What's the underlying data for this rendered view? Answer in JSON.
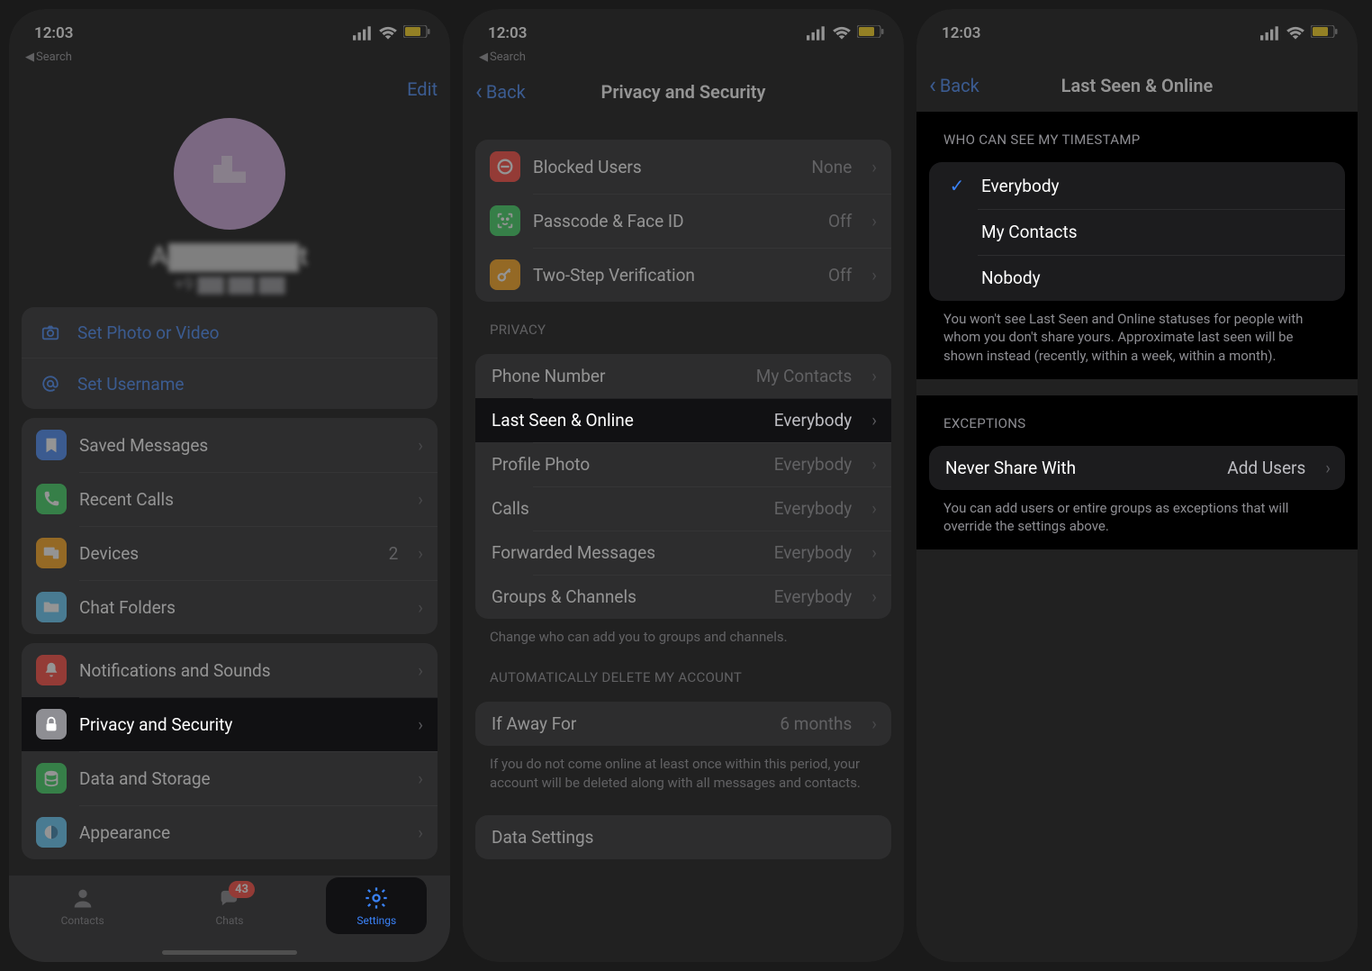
{
  "status": {
    "time": "12:03",
    "breadcrumb_back": "Search"
  },
  "screen1": {
    "edit": "Edit",
    "name_obscured": "A▇▇▇▇▇▇t",
    "phone_obscured": "+9 ▇▇ ▇▇ ▇▇",
    "actions": {
      "set_photo": "Set Photo or Video",
      "set_username": "Set Username"
    },
    "rows1": {
      "saved": "Saved Messages",
      "recent": "Recent Calls",
      "devices": "Devices",
      "devices_val": "2",
      "folders": "Chat Folders"
    },
    "rows2": {
      "notif": "Notifications and Sounds",
      "privacy": "Privacy and Security",
      "data": "Data and Storage",
      "appearance": "Appearance"
    },
    "tabs": {
      "contacts": "Contacts",
      "chats": "Chats",
      "chats_badge": "43",
      "settings": "Settings"
    }
  },
  "screen2": {
    "back": "Back",
    "title": "Privacy and Security",
    "sec1": {
      "blocked": "Blocked Users",
      "blocked_val": "None",
      "passcode": "Passcode & Face ID",
      "passcode_val": "Off",
      "twostep": "Two-Step Verification",
      "twostep_val": "Off"
    },
    "privacy_header": "PRIVACY",
    "privacy": {
      "phone": "Phone Number",
      "phone_val": "My Contacts",
      "lastseen": "Last Seen & Online",
      "lastseen_val": "Everybody",
      "photo": "Profile Photo",
      "photo_val": "Everybody",
      "calls": "Calls",
      "calls_val": "Everybody",
      "fwd": "Forwarded Messages",
      "fwd_val": "Everybody",
      "groups": "Groups & Channels",
      "groups_val": "Everybody"
    },
    "privacy_footer": "Change who can add you to groups and channels.",
    "auto_header": "AUTOMATICALLY DELETE MY ACCOUNT",
    "auto": {
      "away": "If Away For",
      "away_val": "6 months"
    },
    "auto_footer": "If you do not come online at least once within this period, your account will be deleted along with all messages and contacts.",
    "data_settings": "Data Settings"
  },
  "screen3": {
    "back": "Back",
    "title": "Last Seen & Online",
    "who_header": "WHO CAN SEE MY TIMESTAMP",
    "opts": {
      "everybody": "Everybody",
      "contacts": "My Contacts",
      "nobody": "Nobody"
    },
    "who_footer": "You won't see Last Seen and Online statuses for people with whom you don't share yours. Approximate last seen will be shown instead (recently, within a week, within a month).",
    "exc_header": "EXCEPTIONS",
    "exc": {
      "never": "Never Share With",
      "never_val": "Add Users"
    },
    "exc_footer": "You can add users or entire groups as exceptions that will override the settings above."
  },
  "colors": {
    "bookmark": "#3a82f7",
    "phone": "#30d158",
    "devices": "#ff9f0a",
    "folders": "#5ac8fa",
    "notif": "#ff3b30",
    "lock": "#8e8e93",
    "data": "#30d158",
    "appearance": "#5ac8fa",
    "blocked": "#ff3b30",
    "faceid": "#30d158",
    "key": "#ff9f0a"
  }
}
